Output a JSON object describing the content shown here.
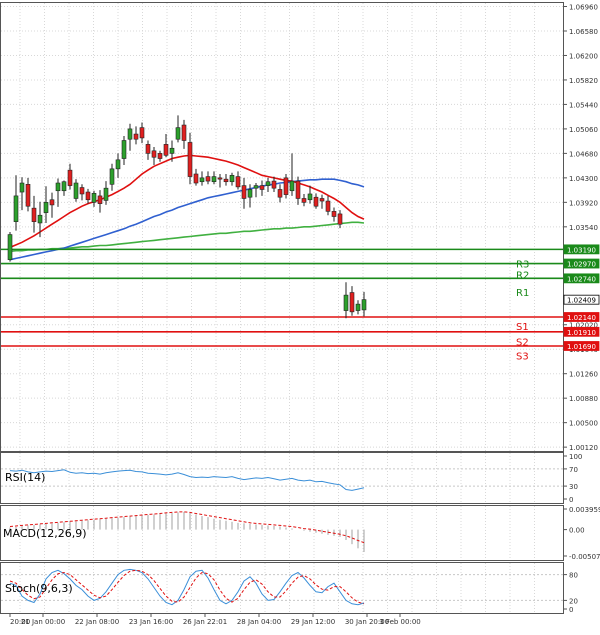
{
  "chart_data": {
    "type": "candlestick",
    "colors": {
      "bull": "#2ca02c",
      "bear": "#e02020",
      "ma_fast": "#e01010",
      "ma_mid": "#3060d0",
      "ma_slow": "#40b040",
      "support": "#e01010",
      "resistance": "#1a8a1a",
      "indicator": "#3b8fd8"
    },
    "price_axis": {
      "ylim": [
        1.0006,
        1.0703
      ],
      "ticks": [
        {
          "value": 1.0696,
          "label": "1.06960"
        },
        {
          "value": 1.0658,
          "label": "1.06580"
        },
        {
          "value": 1.062,
          "label": "1.06200"
        },
        {
          "value": 1.0582,
          "label": "1.05820"
        },
        {
          "value": 1.0544,
          "label": "1.05440"
        },
        {
          "value": 1.0506,
          "label": "1.05060"
        },
        {
          "value": 1.0468,
          "label": "1.04680"
        },
        {
          "value": 1.043,
          "label": "1.04300"
        },
        {
          "value": 1.0392,
          "label": "1.03920"
        },
        {
          "value": 1.0354,
          "label": "1.03540"
        },
        {
          "value": 1.0202,
          "label": "1.02020"
        },
        {
          "value": 1.0164,
          "label": "1.01640"
        },
        {
          "value": 1.0126,
          "label": "1.01260"
        },
        {
          "value": 1.0088,
          "label": "1.00880"
        },
        {
          "value": 1.005,
          "label": "1.00500"
        },
        {
          "value": 1.0012,
          "label": "1.00120"
        }
      ]
    },
    "price_badges": [
      {
        "value": 1.0319,
        "label": "1.03190",
        "kind": "resistance"
      },
      {
        "value": 1.0297,
        "label": "1.02970",
        "kind": "resistance"
      },
      {
        "value": 1.0274,
        "label": "1.02740",
        "kind": "resistance"
      },
      {
        "value": 1.02409,
        "label": "1.02409",
        "kind": "current"
      },
      {
        "value": 1.0214,
        "label": "1.02140",
        "kind": "support"
      },
      {
        "value": 1.0191,
        "label": "1.01910",
        "kind": "support"
      },
      {
        "value": 1.0169,
        "label": "1.01690",
        "kind": "support"
      }
    ],
    "levels": [
      {
        "name": "R3",
        "value": 1.0319,
        "kind": "resistance",
        "label_value": 1.0297
      },
      {
        "name": "R2",
        "value": 1.0297,
        "kind": "resistance",
        "label_value": 1.028
      },
      {
        "name": "R1",
        "value": 1.0274,
        "kind": "resistance",
        "label_value": 1.0253
      },
      {
        "name": "S1",
        "value": 1.0214,
        "kind": "support",
        "label_value": 1.02
      },
      {
        "name": "S2",
        "value": 1.0191,
        "kind": "support",
        "label_value": 1.0176
      },
      {
        "name": "S3",
        "value": 1.0169,
        "kind": "support",
        "label_value": 1.0154
      }
    ],
    "x_axis": {
      "labels": [
        "20:00",
        "21 Jan 00:00",
        "22 Jan 08:00",
        "23 Jan 16:00",
        "26 Jan 22:01",
        "28 Jan 04:00",
        "29 Jan 12:00",
        "30 Jan 20:00",
        "3 Feb 00:00"
      ],
      "label_index": [
        0,
        5.5,
        14.5,
        23.5,
        32.5,
        41.5,
        50.5,
        59.5,
        65
      ]
    },
    "candles": [
      {
        "o": 1.0303,
        "h": 1.0346,
        "l": 1.03,
        "c": 1.0342
      },
      {
        "o": 1.0362,
        "h": 1.0434,
        "l": 1.0348,
        "c": 1.0402
      },
      {
        "o": 1.0408,
        "h": 1.0431,
        "l": 1.038,
        "c": 1.0422
      },
      {
        "o": 1.042,
        "h": 1.043,
        "l": 1.0378,
        "c": 1.0386
      },
      {
        "o": 1.0383,
        "h": 1.0402,
        "l": 1.0345,
        "c": 1.0362
      },
      {
        "o": 1.036,
        "h": 1.0393,
        "l": 1.0338,
        "c": 1.0372
      },
      {
        "o": 1.0376,
        "h": 1.0417,
        "l": 1.036,
        "c": 1.0392
      },
      {
        "o": 1.0396,
        "h": 1.0407,
        "l": 1.0368,
        "c": 1.0388
      },
      {
        "o": 1.041,
        "h": 1.0429,
        "l": 1.0385,
        "c": 1.0422
      },
      {
        "o": 1.041,
        "h": 1.0426,
        "l": 1.0402,
        "c": 1.0424
      },
      {
        "o": 1.0442,
        "h": 1.0452,
        "l": 1.0412,
        "c": 1.0418
      },
      {
        "o": 1.0398,
        "h": 1.0428,
        "l": 1.0393,
        "c": 1.0422
      },
      {
        "o": 1.0415,
        "h": 1.042,
        "l": 1.0395,
        "c": 1.0405
      },
      {
        "o": 1.0408,
        "h": 1.0413,
        "l": 1.039,
        "c": 1.0396
      },
      {
        "o": 1.0392,
        "h": 1.041,
        "l": 1.0385,
        "c": 1.0406
      },
      {
        "o": 1.0402,
        "h": 1.0411,
        "l": 1.0376,
        "c": 1.039
      },
      {
        "o": 1.0395,
        "h": 1.0425,
        "l": 1.0388,
        "c": 1.0414
      },
      {
        "o": 1.042,
        "h": 1.0452,
        "l": 1.041,
        "c": 1.0444
      },
      {
        "o": 1.0444,
        "h": 1.0468,
        "l": 1.043,
        "c": 1.0458
      },
      {
        "o": 1.046,
        "h": 1.0495,
        "l": 1.045,
        "c": 1.0488
      },
      {
        "o": 1.049,
        "h": 1.0514,
        "l": 1.0472,
        "c": 1.0506
      },
      {
        "o": 1.0498,
        "h": 1.051,
        "l": 1.0482,
        "c": 1.049
      },
      {
        "o": 1.0508,
        "h": 1.0516,
        "l": 1.0484,
        "c": 1.0492
      },
      {
        "o": 1.0482,
        "h": 1.0488,
        "l": 1.0458,
        "c": 1.0468
      },
      {
        "o": 1.0472,
        "h": 1.0478,
        "l": 1.045,
        "c": 1.0462
      },
      {
        "o": 1.0468,
        "h": 1.0472,
        "l": 1.0455,
        "c": 1.046
      },
      {
        "o": 1.0482,
        "h": 1.0498,
        "l": 1.0462,
        "c": 1.0465
      },
      {
        "o": 1.0468,
        "h": 1.0488,
        "l": 1.0455,
        "c": 1.0476
      },
      {
        "o": 1.049,
        "h": 1.0527,
        "l": 1.0485,
        "c": 1.0508
      },
      {
        "o": 1.0512,
        "h": 1.052,
        "l": 1.0475,
        "c": 1.0488
      },
      {
        "o": 1.0485,
        "h": 1.05,
        "l": 1.042,
        "c": 1.0432
      },
      {
        "o": 1.0436,
        "h": 1.0444,
        "l": 1.0418,
        "c": 1.0422
      },
      {
        "o": 1.0424,
        "h": 1.044,
        "l": 1.0418,
        "c": 1.043
      },
      {
        "o": 1.0432,
        "h": 1.044,
        "l": 1.042,
        "c": 1.0425
      },
      {
        "o": 1.0424,
        "h": 1.044,
        "l": 1.042,
        "c": 1.0432
      },
      {
        "o": 1.043,
        "h": 1.0436,
        "l": 1.0415,
        "c": 1.0428
      },
      {
        "o": 1.0428,
        "h": 1.0436,
        "l": 1.0418,
        "c": 1.0424
      },
      {
        "o": 1.0424,
        "h": 1.0438,
        "l": 1.0418,
        "c": 1.0434
      },
      {
        "o": 1.0432,
        "h": 1.044,
        "l": 1.0412,
        "c": 1.0416
      },
      {
        "o": 1.0418,
        "h": 1.043,
        "l": 1.0382,
        "c": 1.0398
      },
      {
        "o": 1.04,
        "h": 1.042,
        "l": 1.0384,
        "c": 1.0412
      },
      {
        "o": 1.0414,
        "h": 1.0422,
        "l": 1.04,
        "c": 1.0418
      },
      {
        "o": 1.0418,
        "h": 1.0426,
        "l": 1.0402,
        "c": 1.0412
      },
      {
        "o": 1.0418,
        "h": 1.043,
        "l": 1.0408,
        "c": 1.0424
      },
      {
        "o": 1.0425,
        "h": 1.0432,
        "l": 1.0408,
        "c": 1.0414
      },
      {
        "o": 1.0412,
        "h": 1.042,
        "l": 1.0392,
        "c": 1.04
      },
      {
        "o": 1.043,
        "h": 1.0436,
        "l": 1.0398,
        "c": 1.0404
      },
      {
        "o": 1.041,
        "h": 1.0468,
        "l": 1.0402,
        "c": 1.0425
      },
      {
        "o": 1.0425,
        "h": 1.0432,
        "l": 1.0388,
        "c": 1.0398
      },
      {
        "o": 1.0398,
        "h": 1.0405,
        "l": 1.0386,
        "c": 1.0392
      },
      {
        "o": 1.0396,
        "h": 1.0418,
        "l": 1.039,
        "c": 1.0405
      },
      {
        "o": 1.04,
        "h": 1.0406,
        "l": 1.0382,
        "c": 1.0386
      },
      {
        "o": 1.0398,
        "h": 1.0404,
        "l": 1.0382,
        "c": 1.0394
      },
      {
        "o": 1.0394,
        "h": 1.0402,
        "l": 1.0372,
        "c": 1.0378
      },
      {
        "o": 1.0378,
        "h": 1.0384,
        "l": 1.0362,
        "c": 1.037
      },
      {
        "o": 1.0374,
        "h": 1.038,
        "l": 1.0352,
        "c": 1.0358
      },
      {
        "o": 1.0224,
        "h": 1.0268,
        "l": 1.0212,
        "c": 1.0248
      },
      {
        "o": 1.0252,
        "h": 1.0262,
        "l": 1.0216,
        "c": 1.0222
      },
      {
        "o": 1.0224,
        "h": 1.024,
        "l": 1.0218,
        "c": 1.0234
      },
      {
        "o": 1.0225,
        "h": 1.0253,
        "l": 1.0215,
        "c": 1.0241
      }
    ],
    "ma_fast": [
      1.0322,
      1.0326,
      1.033,
      1.0335,
      1.034,
      1.0346,
      1.0352,
      1.0358,
      1.0364,
      1.037,
      1.0376,
      1.0381,
      1.0386,
      1.039,
      1.0393,
      1.0396,
      1.04,
      1.0404,
      1.0409,
      1.0414,
      1.042,
      1.0428,
      1.0436,
      1.0442,
      1.0448,
      1.0452,
      1.0456,
      1.046,
      1.0462,
      1.0464,
      1.0465,
      1.0464,
      1.0463,
      1.0462,
      1.046,
      1.0458,
      1.0456,
      1.0453,
      1.045,
      1.0446,
      1.0442,
      1.0438,
      1.0434,
      1.0432,
      1.043,
      1.0428,
      1.0426,
      1.0425,
      1.0422,
      1.0419,
      1.0416,
      1.0412,
      1.0408,
      1.0403,
      1.0398,
      1.0392,
      1.0384,
      1.0376,
      1.037,
      1.0366
    ],
    "ma_mid": [
      1.0303,
      1.0305,
      1.0307,
      1.0309,
      1.0311,
      1.0313,
      1.0315,
      1.0317,
      1.0319,
      1.0321,
      1.0324,
      1.0327,
      1.033,
      1.0333,
      1.0336,
      1.0339,
      1.0342,
      1.0345,
      1.0348,
      1.0351,
      1.0355,
      1.0358,
      1.0362,
      1.0366,
      1.037,
      1.0373,
      1.0377,
      1.038,
      1.0384,
      1.0387,
      1.039,
      1.0393,
      1.0396,
      1.0399,
      1.0401,
      1.0403,
      1.0405,
      1.0407,
      1.0409,
      1.0411,
      1.0413,
      1.0415,
      1.0417,
      1.0419,
      1.042,
      1.0422,
      1.0423,
      1.0424,
      1.0425,
      1.0426,
      1.0427,
      1.0427,
      1.0428,
      1.0428,
      1.0428,
      1.0426,
      1.0424,
      1.0421,
      1.0419,
      1.0416
    ],
    "ma_slow": [
      1.0316,
      1.0317,
      1.0317,
      1.0318,
      1.0318,
      1.0319,
      1.0319,
      1.032,
      1.032,
      1.0321,
      1.0321,
      1.0322,
      1.0323,
      1.0323,
      1.0324,
      1.0325,
      1.0325,
      1.0326,
      1.0327,
      1.0328,
      1.0329,
      1.033,
      1.0331,
      1.0332,
      1.0333,
      1.0334,
      1.0335,
      1.0336,
      1.0337,
      1.0338,
      1.0339,
      1.034,
      1.0341,
      1.0342,
      1.0343,
      1.0344,
      1.0344,
      1.0345,
      1.0346,
      1.0347,
      1.0347,
      1.0348,
      1.0349,
      1.035,
      1.0351,
      1.0351,
      1.0352,
      1.0352,
      1.0353,
      1.0354,
      1.0354,
      1.0355,
      1.0356,
      1.0357,
      1.0358,
      1.0359,
      1.036,
      1.0361,
      1.0361,
      1.036
    ],
    "rsi": {
      "label": "RSI(14)",
      "ylim": [
        0,
        100
      ],
      "ticks": [
        {
          "value": 100,
          "label": "100"
        },
        {
          "value": 70,
          "label": "70"
        },
        {
          "value": 30,
          "label": "30"
        },
        {
          "value": 0,
          "label": "0"
        }
      ],
      "values": [
        66,
        65,
        67,
        63,
        61,
        63,
        65,
        64,
        66,
        68,
        62,
        60,
        61,
        59,
        60,
        58,
        61,
        63,
        65,
        66,
        67,
        64,
        63,
        60,
        59,
        58,
        56,
        58,
        61,
        57,
        52,
        50,
        51,
        50,
        52,
        51,
        50,
        52,
        48,
        45,
        47,
        49,
        48,
        50,
        47,
        44,
        46,
        48,
        44,
        42,
        44,
        40,
        41,
        38,
        35,
        33,
        22,
        20,
        23,
        26
      ]
    },
    "macd": {
      "label": "MACD(12,26,9)",
      "ylim": [
        -0.005074,
        0.003959
      ],
      "ticks": [
        {
          "value": 0.003959,
          "label": "0.003959"
        },
        {
          "value": 0,
          "label": "0.00"
        },
        {
          "value": -0.005074,
          "label": "-0.005074"
        }
      ],
      "histogram": [
        0.0004,
        0.0005,
        0.0007,
        0.0008,
        0.0009,
        0.001,
        0.0011,
        0.0012,
        0.0013,
        0.0014,
        0.0015,
        0.0016,
        0.0017,
        0.0018,
        0.0019,
        0.002,
        0.0021,
        0.0022,
        0.0023,
        0.0024,
        0.0025,
        0.0026,
        0.0027,
        0.0028,
        0.0029,
        0.003,
        0.0031,
        0.0032,
        0.0033,
        0.0034,
        0.0032,
        0.0029,
        0.0026,
        0.0024,
        0.0021,
        0.0019,
        0.0017,
        0.0015,
        0.0013,
        0.0012,
        0.0011,
        0.001,
        0.0009,
        0.0008,
        0.0007,
        0.0006,
        0.0004,
        0.0002,
        0.0,
        -0.0002,
        -0.0004,
        -0.0006,
        -0.0008,
        -0.001,
        -0.0012,
        -0.0014,
        -0.002,
        -0.0028,
        -0.0036,
        -0.0043
      ],
      "signal": [
        0.0006,
        0.0007,
        0.0008,
        0.0009,
        0.001,
        0.0011,
        0.0012,
        0.0013,
        0.0014,
        0.0015,
        0.0016,
        0.0017,
        0.0018,
        0.0019,
        0.002,
        0.0021,
        0.0022,
        0.0023,
        0.0024,
        0.0025,
        0.0026,
        0.0027,
        0.0028,
        0.0029,
        0.003,
        0.0031,
        0.0032,
        0.0033,
        0.0034,
        0.0034,
        0.0033,
        0.0031,
        0.0029,
        0.0027,
        0.0025,
        0.0023,
        0.0021,
        0.0019,
        0.0017,
        0.0015,
        0.0013,
        0.0012,
        0.0011,
        0.001,
        0.0009,
        0.0008,
        0.0007,
        0.0006,
        0.0004,
        0.0002,
        0.0001,
        -0.0001,
        -0.0003,
        -0.0005,
        -0.0007,
        -0.0009,
        -0.0012,
        -0.0016,
        -0.0021,
        -0.0025
      ]
    },
    "stoch": {
      "label": "Stoch(9,6,3)",
      "ylim": [
        0,
        100
      ],
      "ticks": [
        {
          "value": 80,
          "label": "80"
        },
        {
          "value": 20,
          "label": "20"
        },
        {
          "value": 0,
          "label": "0"
        }
      ],
      "k": [
        60,
        55,
        30,
        20,
        15,
        35,
        70,
        85,
        90,
        82,
        70,
        55,
        45,
        30,
        20,
        25,
        40,
        60,
        80,
        90,
        92,
        90,
        85,
        70,
        50,
        30,
        15,
        10,
        20,
        45,
        75,
        88,
        90,
        72,
        45,
        20,
        12,
        20,
        40,
        65,
        75,
        60,
        35,
        20,
        22,
        40,
        60,
        78,
        85,
        72,
        55,
        40,
        38,
        52,
        60,
        40,
        20,
        12,
        10,
        14
      ],
      "d": [
        65,
        60,
        45,
        32,
        24,
        28,
        48,
        68,
        82,
        85,
        80,
        68,
        56,
        44,
        32,
        26,
        30,
        45,
        62,
        78,
        88,
        90,
        88,
        80,
        66,
        48,
        30,
        18,
        16,
        28,
        50,
        72,
        85,
        82,
        68,
        44,
        25,
        16,
        25,
        45,
        62,
        68,
        58,
        40,
        28,
        28,
        42,
        60,
        74,
        78,
        70,
        56,
        46,
        44,
        52,
        52,
        40,
        26,
        16,
        12
      ]
    }
  }
}
